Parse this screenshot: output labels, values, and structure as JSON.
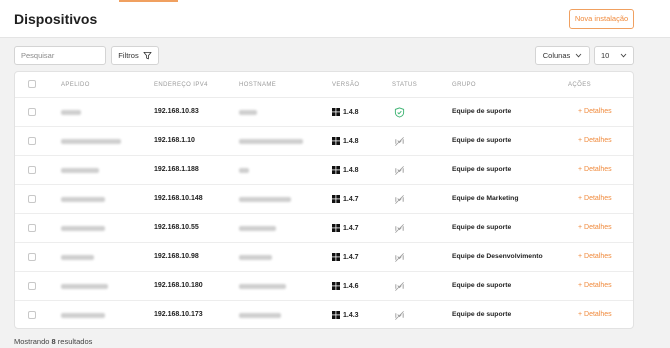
{
  "header": {
    "title": "Dispositivos",
    "new_install_label": "Nova instalação",
    "accent_color": "#f0a060"
  },
  "toolbar": {
    "search_placeholder": "Pesquisar",
    "filter_label": "Filtros",
    "columns_label": "Colunas",
    "page_size": "10"
  },
  "table": {
    "columns": [
      "APELIDO",
      "ENDEREÇO IPV4",
      "HOSTNAME",
      "VERSÃO",
      "STATUS",
      "GRUPO",
      "AÇÕES"
    ],
    "rows": [
      {
        "ip": "192.168.10.83",
        "version": "1.4.8",
        "status": "online",
        "group": "Equipe de suporte",
        "action": "+ Detalhes"
      },
      {
        "ip": "192.168.1.10",
        "version": "1.4.8",
        "status": "offline",
        "group": "Equipe de suporte",
        "action": "+ Detalhes"
      },
      {
        "ip": "192.168.1.188",
        "version": "1.4.8",
        "status": "offline",
        "group": "Equipe de suporte",
        "action": "+ Detalhes"
      },
      {
        "ip": "192.168.10.148",
        "version": "1.4.7",
        "status": "offline",
        "group": "Equipe de Marketing",
        "action": "+ Detalhes"
      },
      {
        "ip": "192.168.10.55",
        "version": "1.4.7",
        "status": "offline",
        "group": "Equipe de suporte",
        "action": "+ Detalhes"
      },
      {
        "ip": "192.168.10.98",
        "version": "1.4.7",
        "status": "offline",
        "group": "Equipe de Desenvolvimento",
        "action": "+ Detalhes"
      },
      {
        "ip": "192.168.10.180",
        "version": "1.4.6",
        "status": "offline",
        "group": "Equipe de suporte",
        "action": "+ Detalhes"
      },
      {
        "ip": "192.168.10.173",
        "version": "1.4.3",
        "status": "offline",
        "group": "Equipe de suporte",
        "action": "+ Detalhes"
      }
    ]
  },
  "footer": {
    "prefix": "Mostrando",
    "count": "8",
    "suffix": "resultados"
  },
  "colors": {
    "online_status": "#3cb371",
    "offline_status": "#9a9a9a",
    "action_link": "#f08a3c"
  }
}
